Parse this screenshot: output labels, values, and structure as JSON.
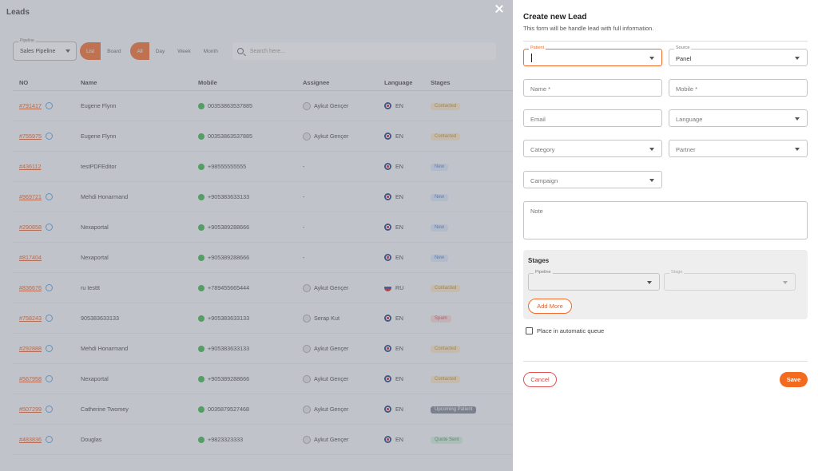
{
  "background": {
    "page_title": "Leads",
    "pipeline": {
      "label": "Pipeline",
      "value": "Sales Pipeline"
    },
    "view_toggle": [
      "List",
      "Board"
    ],
    "period_toggle": [
      "All",
      "Day",
      "Week",
      "Month"
    ],
    "search_placeholder": "Search here...",
    "columns": [
      "NO",
      "Name",
      "Mobile",
      "Assignee",
      "Language",
      "Stages"
    ],
    "rows": [
      {
        "no": "#791417",
        "name": "Eugene Flynn",
        "mobile": "00353863537885",
        "assignee": "Aykut Gençer",
        "lang": "EN",
        "stage": "Contacted"
      },
      {
        "no": "#755975",
        "name": "Eugene Flynn",
        "mobile": "00353863537885",
        "assignee": "Aykut Gençer",
        "lang": "EN",
        "stage": "Contacted"
      },
      {
        "no": "#436112",
        "name": "testPDFEditor",
        "mobile": "+98555555555",
        "assignee": "-",
        "lang": "EN",
        "stage": "New"
      },
      {
        "no": "#969721",
        "name": "Mehdi Honarmand",
        "mobile": "+905383633133",
        "assignee": "-",
        "lang": "EN",
        "stage": "New"
      },
      {
        "no": "#290858",
        "name": "Nexaportal",
        "mobile": "+905389288666",
        "assignee": "-",
        "lang": "EN",
        "stage": "New"
      },
      {
        "no": "#817404",
        "name": "Nexaportal",
        "mobile": "+905389288666",
        "assignee": "-",
        "lang": "EN",
        "stage": "New"
      },
      {
        "no": "#836676",
        "name": "ru testtt",
        "mobile": "+789455665444",
        "assignee": "Aykut Gençer",
        "lang": "RU",
        "stage": "Contacted"
      },
      {
        "no": "#758243",
        "name": "905383633133",
        "mobile": "+905383633133",
        "assignee": "Serap Kut",
        "lang": "EN",
        "stage": "Spam"
      },
      {
        "no": "#292888",
        "name": "Mehdi Honarmand",
        "mobile": "+905383633133",
        "assignee": "Aykut Gençer",
        "lang": "EN",
        "stage": "Contacted"
      },
      {
        "no": "#567958",
        "name": "Nexaportal",
        "mobile": "+905389288666",
        "assignee": "Aykut Gençer",
        "lang": "EN",
        "stage": "Contacted"
      },
      {
        "no": "#507299",
        "name": "Catherine Twomey",
        "mobile": "0035879527468",
        "assignee": "Aykut Gençer",
        "lang": "EN",
        "stage": "Upcoming Patient"
      },
      {
        "no": "#483836",
        "name": "Douglas",
        "mobile": "+9823323333",
        "assignee": "Aykut Gençer",
        "lang": "EN",
        "stage": "Quote Sent"
      }
    ]
  },
  "form": {
    "title": "Create new Lead",
    "subtitle": "This form will be handle lead with full information.",
    "patient_label": "Patient",
    "source_label": "Source",
    "source_value": "Panel",
    "name_placeholder": "Name *",
    "mobile_placeholder": "Mobile *",
    "email_placeholder": "Email",
    "language_placeholder": "Language",
    "category_placeholder": "Category",
    "partner_placeholder": "Partner",
    "campaign_placeholder": "Campaign",
    "note_placeholder": "Note",
    "stages_title": "Stages",
    "stage_pipeline_label": "Pipeline",
    "stage_label": "Stage",
    "add_more": "Add More",
    "queue_label": "Place in automatic queue",
    "cancel": "Cancel",
    "save": "Save"
  },
  "colors": {
    "accent": "#f26b1f",
    "cancel": "#d64545"
  }
}
